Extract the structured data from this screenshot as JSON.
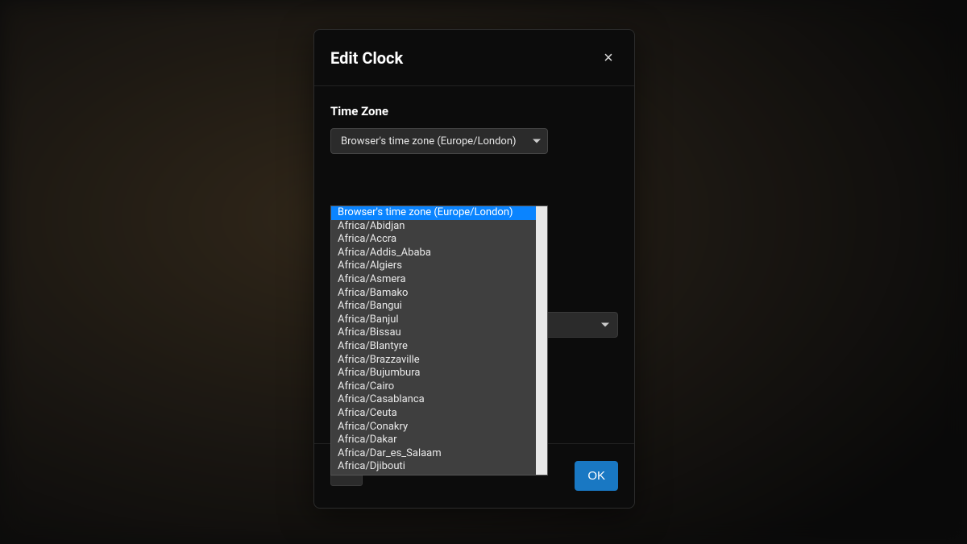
{
  "modal": {
    "title": "Edit Clock",
    "close": "×"
  },
  "field": {
    "label": "Time Zone"
  },
  "select": {
    "current": "Browser's time zone (Europe/London)"
  },
  "dropdown": {
    "options": [
      "Browser's time zone (Europe/London)",
      "Africa/Abidjan",
      "Africa/Accra",
      "Africa/Addis_Ababa",
      "Africa/Algiers",
      "Africa/Asmera",
      "Africa/Bamako",
      "Africa/Bangui",
      "Africa/Banjul",
      "Africa/Bissau",
      "Africa/Blantyre",
      "Africa/Brazzaville",
      "Africa/Bujumbura",
      "Africa/Cairo",
      "Africa/Casablanca",
      "Africa/Ceuta",
      "Africa/Conakry",
      "Africa/Dakar",
      "Africa/Dar_es_Salaam",
      "Africa/Djibouti"
    ],
    "selected_index": 0
  },
  "footer": {
    "ok": "OK"
  }
}
